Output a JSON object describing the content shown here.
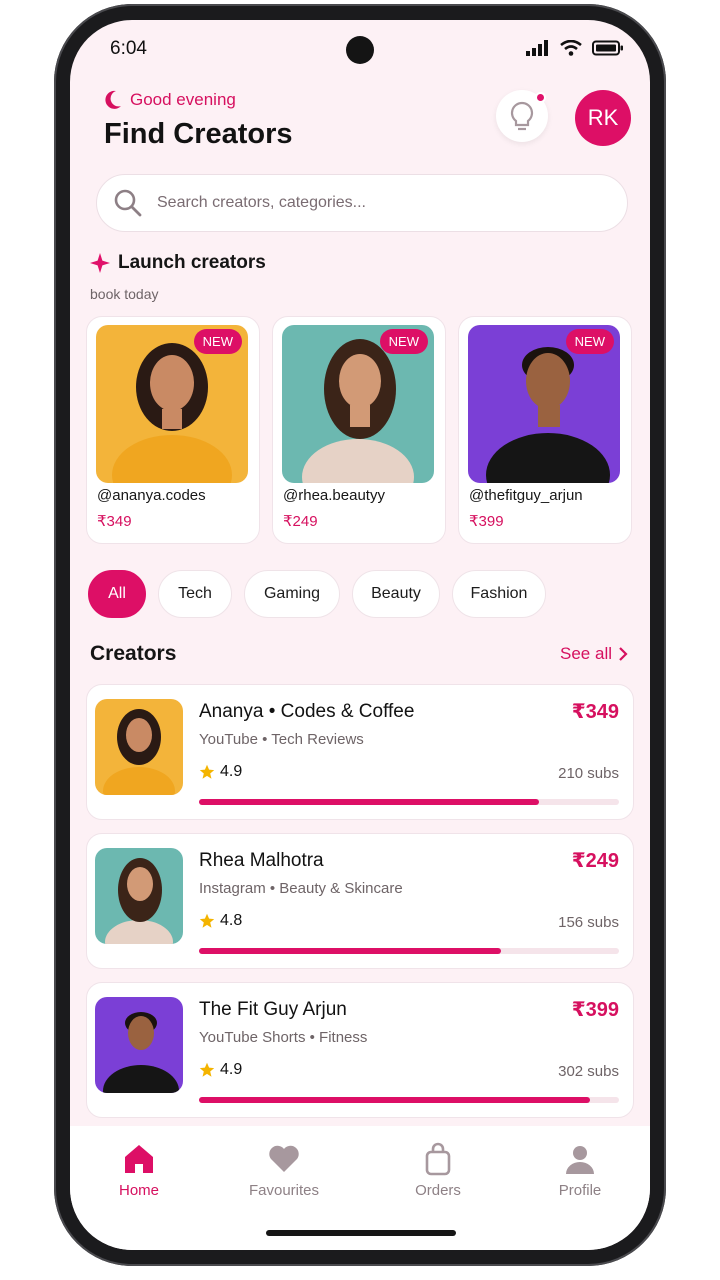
{
  "status_bar": {
    "time": "6:04"
  },
  "header": {
    "greeting": "Good evening",
    "title": "Find Creators",
    "avatar_initials": "RK",
    "accent": "#dd0f66"
  },
  "search": {
    "placeholder": "Search creators, categories..."
  },
  "launch": {
    "title": "Launch creators",
    "subtitle": "book today",
    "cards": [
      {
        "badge": "NEW",
        "handle": "@ananya.codes",
        "price": "₹349",
        "bg": "#f3b43a"
      },
      {
        "badge": "NEW",
        "handle": "@rhea.beautyy",
        "price": "₹249",
        "bg": "#6cb8b0"
      },
      {
        "badge": "NEW",
        "handle": "@thefitguy_arjun",
        "price": "₹399",
        "bg": "#7b3fd6"
      }
    ]
  },
  "filters": {
    "chips": [
      "All",
      "Tech",
      "Gaming",
      "Beauty",
      "Fashion"
    ],
    "active": "All"
  },
  "creators": {
    "title": "Creators",
    "see_all": "See all",
    "rows": [
      {
        "name": "Ananya • Codes & Coffee",
        "meta": "YouTube • Tech Reviews",
        "price": "₹349",
        "rating": "4.9",
        "subs": "210 subs",
        "progress": 0.81,
        "bg": "#f3b43a"
      },
      {
        "name": "Rhea Malhotra",
        "meta": "Instagram • Beauty & Skincare",
        "price": "₹249",
        "rating": "4.8",
        "subs": "156 subs",
        "progress": 0.72,
        "bg": "#6cb8b0"
      },
      {
        "name": "The Fit Guy Arjun",
        "meta": "YouTube Shorts • Fitness",
        "price": "₹399",
        "rating": "4.9",
        "subs": "302 subs",
        "progress": 0.93,
        "bg": "#7b3fd6"
      }
    ]
  },
  "tabbar": {
    "tabs": [
      {
        "label": "Home",
        "icon": "home-icon"
      },
      {
        "label": "Favourites",
        "icon": "heart-icon"
      },
      {
        "label": "Orders",
        "icon": "bag-icon"
      },
      {
        "label": "Profile",
        "icon": "user-icon"
      }
    ],
    "active": "Home"
  }
}
